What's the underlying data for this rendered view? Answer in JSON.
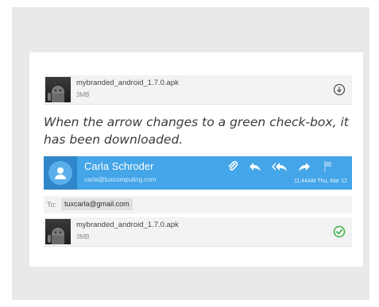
{
  "attachment_top": {
    "filename": "mybranded_android_1.7.0.apk",
    "size": "3MB",
    "icon": "download-icon"
  },
  "caption": "When the arrow changes to a green check-box, it has been downloaded.",
  "email": {
    "sender_name": "Carla Schroder",
    "sender_email": "carla@tuxcomputing.com",
    "timestamp": "11:44AM Thu, Mar 12",
    "header_color": "#44a5e8",
    "actions": [
      "paperclip-icon",
      "reply-icon",
      "reply-all-icon",
      "forward-icon",
      "flag-icon"
    ],
    "to_label": "To:",
    "to_address": "tuxcarla@gmail.com"
  },
  "attachment_bottom": {
    "filename": "mybranded_android_1.7.0.apk",
    "size": "3MB",
    "icon": "downloaded-check-icon",
    "status_color": "#3cb043"
  }
}
